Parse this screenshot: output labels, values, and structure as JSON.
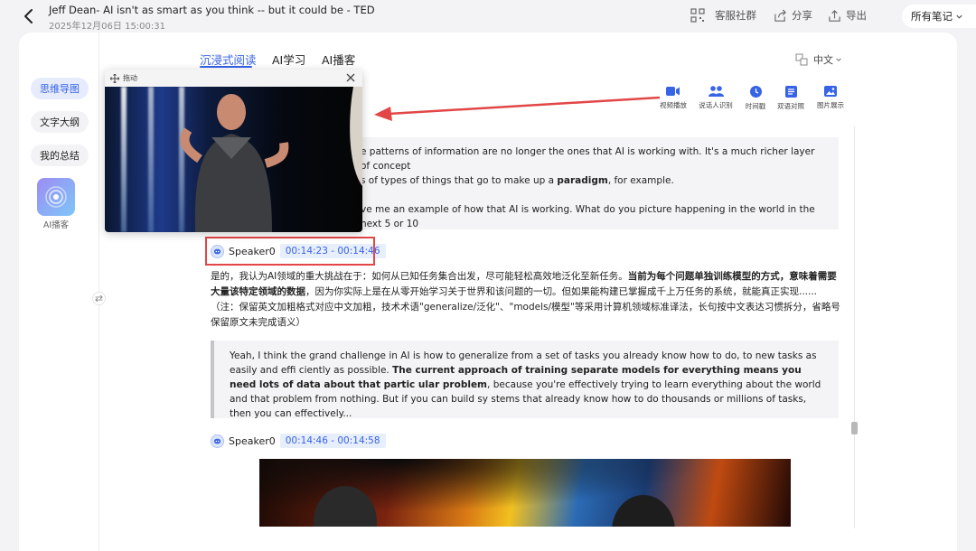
{
  "header": {
    "title": "Jeff Dean- AI isn't as smart as you think -- but it could be - TED",
    "date": "2025年12月06日 15:00:31",
    "actions": {
      "service": "客服社群",
      "share": "分享",
      "export": "导出",
      "all_notes": "所有笔记"
    }
  },
  "sidebar": {
    "items": [
      {
        "label": "思维导图"
      },
      {
        "label": "文字大纲"
      },
      {
        "label": "我的总结"
      }
    ],
    "podcast_label": "AI播客"
  },
  "tabs": [
    {
      "label": "沉浸式阅读"
    },
    {
      "label": "AI学习"
    },
    {
      "label": "AI播客"
    }
  ],
  "language": "中文",
  "toolbar": [
    {
      "label": "视频播放",
      "icon": "video-icon"
    },
    {
      "label": "说话人识别",
      "icon": "speakers-icon"
    },
    {
      "label": "时间戳",
      "icon": "clock-icon"
    },
    {
      "label": "双语对照",
      "icon": "bilingual-icon"
    },
    {
      "label": "图片展示",
      "icon": "image-icon"
    }
  ],
  "player": {
    "drag_label": "拖动"
  },
  "content": {
    "first_quote": {
      "line1_a": "e patterns of information are no longer the ones that AI is working with. It's a much richer layer of concept",
      "line2_a": "s of types of things that go to make up a ",
      "line2_b": "paradigm",
      "line2_c": ", for example.",
      "line3_a": "ve me an example of how that AI is working. What do you picture happening in the world in the next 5 or 10"
    },
    "speaker_1": {
      "name": "Speaker0",
      "time": "00:14:23 - 00:14:46"
    },
    "cn": {
      "p1": "是的，我认为AI领域的重大挑战在于：如何从已知任务集合出发，尽可能轻松高效地泛化至新任务。",
      "p1_bold": "当前为每个问题单独训练模型的方式，意味着需要大量该特定领域的数据",
      "p2": "，因为你实际上是在从零开始学习关于世界和该问题的一切。但如果能构建已掌握成千上万任务的系统，就能真正实现......",
      "note": "（注：保留英文加粗格式对应中文加粗，技术术语\"generalize/泛化\"、\"models/模型\"等采用计算机领域标准译法，长句按中文表达习惯拆分，省略号保留原文未完成语义）"
    },
    "en": {
      "p1": "Yeah, I think the grand challenge in AI is how to generalize from a set of tasks you already know how to do, to new tasks as easily and effi ciently as possible. ",
      "bold": "The current approach of training separate models for everything means you need lots of data about that partic ular problem",
      "p2": ", because you're effectively trying to learn everything about the world and that problem from nothing. But if you can build sy stems that already know how to do thousands or millions of tasks, then you can effectively..."
    },
    "speaker_2": {
      "name": "Speaker0",
      "time": "00:14:46 - 00:14:58"
    }
  }
}
